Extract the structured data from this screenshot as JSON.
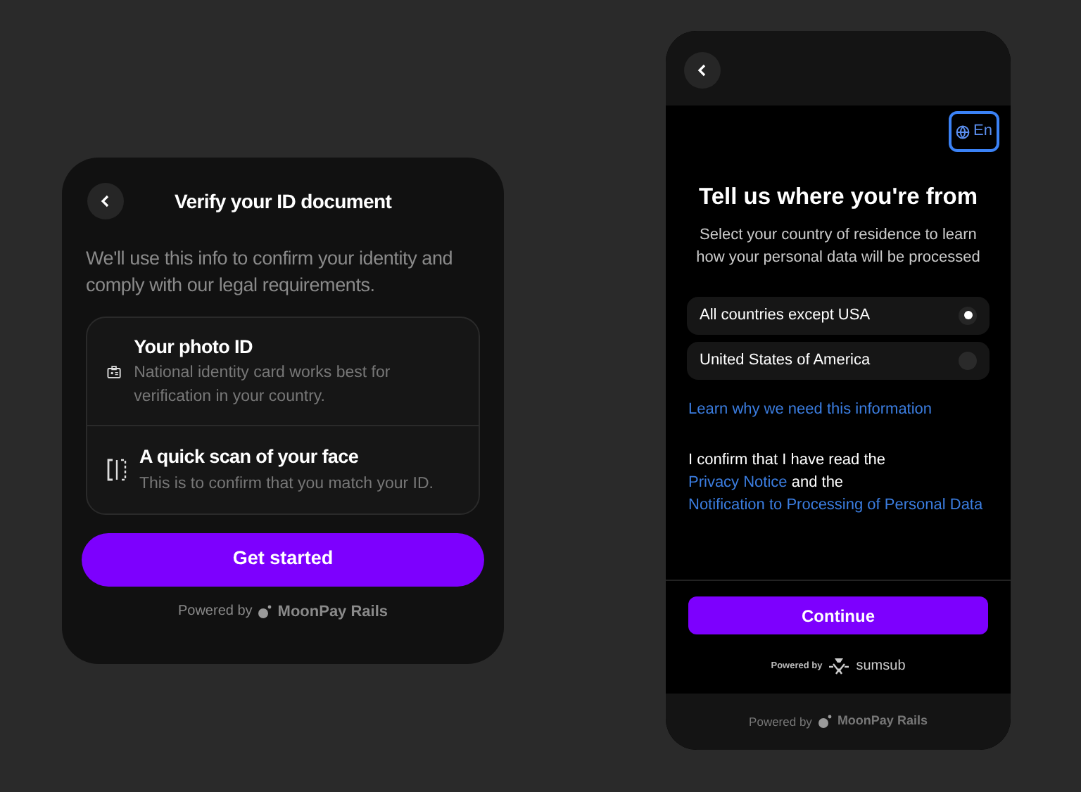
{
  "verify_card": {
    "title": "Verify your ID document",
    "intro": "We'll use this info to confirm your identity and comply with our legal requirements.",
    "steps": [
      {
        "kind": "id",
        "title": "Your photo ID",
        "description": "National identity card works best for verification in your country."
      },
      {
        "kind": "face",
        "title": "A quick scan of your face",
        "description": "This is to confirm that you match your ID."
      }
    ],
    "button": "Get started",
    "powered_by": "Powered by",
    "brand": "MoonPay Rails"
  },
  "country_card": {
    "language": "En",
    "title": "Tell us where you're from",
    "subtitle": "Select your country of residence to learn how your personal data will be processed",
    "options": [
      {
        "label": "All countries except USA",
        "selected": true
      },
      {
        "label": "United States of America",
        "selected": false
      }
    ],
    "learn_link": "Learn why we need this information",
    "consent": [
      {
        "kind": "text",
        "text": "I confirm that I have read the "
      },
      {
        "kind": "link",
        "text": "Privacy Notice"
      },
      {
        "kind": "text",
        "text": " and the "
      },
      {
        "kind": "link",
        "text": "Notification to Processing of Personal Data"
      }
    ],
    "button": "Continue",
    "sumsub_powered_by": "Powered by",
    "sumsub_brand": "sumsub",
    "footer_powered_by": "Powered by",
    "footer_brand": "MoonPay Rails"
  }
}
